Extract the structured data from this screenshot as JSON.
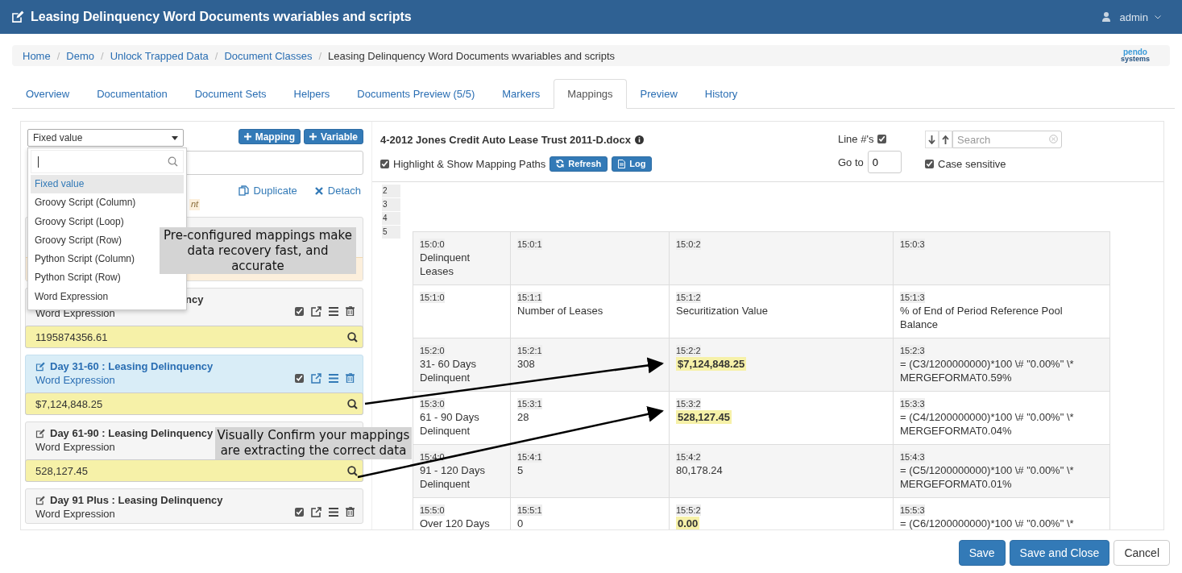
{
  "header": {
    "title": "Leasing Delinquency Word Documents wvariables and scripts",
    "user": "admin"
  },
  "breadcrumb_separator": "/",
  "breadcrumb": [
    "Home",
    "Demo",
    "Unlock Trapped Data",
    "Document Classes",
    "Leasing Delinquency Word Documents wvariables and scripts"
  ],
  "logo": [
    "pendo",
    "systems"
  ],
  "tabs": [
    {
      "label": "Overview",
      "selected": false
    },
    {
      "label": "Documentation",
      "selected": false
    },
    {
      "label": "Document Sets",
      "selected": false
    },
    {
      "label": "Helpers",
      "selected": false
    },
    {
      "label": "Documents Preview (5/5)",
      "selected": false
    },
    {
      "label": "Markers",
      "selected": false
    },
    {
      "label": "Mappings",
      "selected": true
    },
    {
      "label": "Preview",
      "selected": false
    },
    {
      "label": "History",
      "selected": false
    }
  ],
  "left": {
    "select": "Fixed value",
    "buttons": [
      "Mapping",
      "Variable"
    ],
    "links": [
      "Duplicate",
      "Detach"
    ],
    "note": "nt",
    "dropdown": [
      {
        "label": "Fixed value",
        "selected": true
      },
      {
        "label": "Groovy Script (Column)",
        "selected": false
      },
      {
        "label": "Groovy Script (Loop)",
        "selected": false
      },
      {
        "label": "Groovy Script (Row)",
        "selected": false
      },
      {
        "label": "Python Script (Column)",
        "selected": false
      },
      {
        "label": "Python Script (Row)",
        "selected": false
      },
      {
        "label": "Word Expression",
        "selected": false
      }
    ],
    "cards": [
      {
        "title": "ncy",
        "title_cut": true,
        "subtitle": "Word Expression",
        "value": "1195874356.61",
        "selected": false,
        "checked": true
      },
      {
        "title": "Day 31-60 : Leasing Delinquency",
        "title_cut": false,
        "subtitle": "Word Expression",
        "value": "$7,124,848.25",
        "selected": true,
        "checked": true
      },
      {
        "title": "Day 61-90 : Leasing Delinquency",
        "title_cut": false,
        "subtitle": "Word Expression",
        "value": "528,127.45",
        "selected": false
      },
      {
        "title": "Day 91 Plus : Leasing Delinquency",
        "title_cut": false,
        "subtitle": "Word Expression",
        "selected": false,
        "checked": true
      }
    ]
  },
  "callouts": [
    "Pre-configured mappings make data recovery fast, and accurate",
    "Visually Confirm your mappings are extracting the correct data"
  ],
  "viewer": {
    "doc_title": "4-2012 Jones Credit Auto Lease Trust 2011-D.docx",
    "line_numbers_label": "Line #'s",
    "line_numbers_on": true,
    "highlight_label": "Highlight & Show Mapping Paths",
    "highlight_on": true,
    "buttons": [
      "Refresh",
      "Log"
    ],
    "goto_label": "Go to",
    "goto_value": "0",
    "search_placeholder": "Search",
    "case_label": "Case sensitive",
    "case_on": true,
    "lines": [
      "2",
      "3",
      "4",
      "5"
    ],
    "rows": [
      [
        {
          "code": "15:0:0",
          "text": "Delinquent Leases",
          "highlight": false
        },
        {
          "code": "15:0:1"
        },
        {
          "code": "15:0:2"
        },
        {
          "code": "15:0:3"
        }
      ],
      [
        {
          "code": "15:1:0"
        },
        {
          "code": "15:1:1",
          "text": "Number of Leases",
          "highlight": false
        },
        {
          "code": "15:1:2",
          "text": "Securitization Value",
          "highlight": false
        },
        {
          "code": "15:1:3",
          "text": "% of End of Period Reference Pool Balance",
          "highlight": false
        }
      ],
      [
        {
          "code": "15:2:0",
          "text": "31- 60 Days Delinquent",
          "highlight": false
        },
        {
          "code": "15:2:1",
          "text": "308",
          "highlight": false
        },
        {
          "code": "15:2:2",
          "text": "$7,124,848.25",
          "highlight": true
        },
        {
          "code": "15:2:3",
          "text": "= (C3/1200000000)*100 \\# \"0.00%\" \\* MERGEFORMAT0.59%",
          "highlight": false
        }
      ],
      [
        {
          "code": "15:3:0",
          "text": "61 - 90 Days Delinquent",
          "highlight": false
        },
        {
          "code": "15:3:1",
          "text": "28",
          "highlight": false
        },
        {
          "code": "15:3:2",
          "text": "528,127.45",
          "highlight": true
        },
        {
          "code": "15:3:3",
          "text": "= (C4/1200000000)*100 \\# \"0.00%\" \\* MERGEFORMAT0.04%",
          "highlight": false
        }
      ],
      [
        {
          "code": "15:4:0",
          "text": "91 - 120 Days Delinquent",
          "highlight": false
        },
        {
          "code": "15:4:1",
          "text": "5",
          "highlight": false
        },
        {
          "code": "15:4:2",
          "text": "80,178.24",
          "highlight": false
        },
        {
          "code": "15:4:3",
          "text": "= (C5/1200000000)*100 \\# \"0.00%\" \\* MERGEFORMAT0.01%",
          "highlight": false
        }
      ],
      [
        {
          "code": "15:5:0",
          "text": "Over 120 Days",
          "highlight": false
        },
        {
          "code": "15:5:1",
          "text": "0",
          "highlight": false
        },
        {
          "code": "15:5:2",
          "text": "0.00",
          "highlight": true
        },
        {
          "code": "15:5:3",
          "text": "= (C6/1200000000)*100 \\# \"0.00%\" \\*",
          "highlight": false
        }
      ]
    ]
  },
  "footer": [
    "Save",
    "Save and Close",
    "Cancel"
  ]
}
